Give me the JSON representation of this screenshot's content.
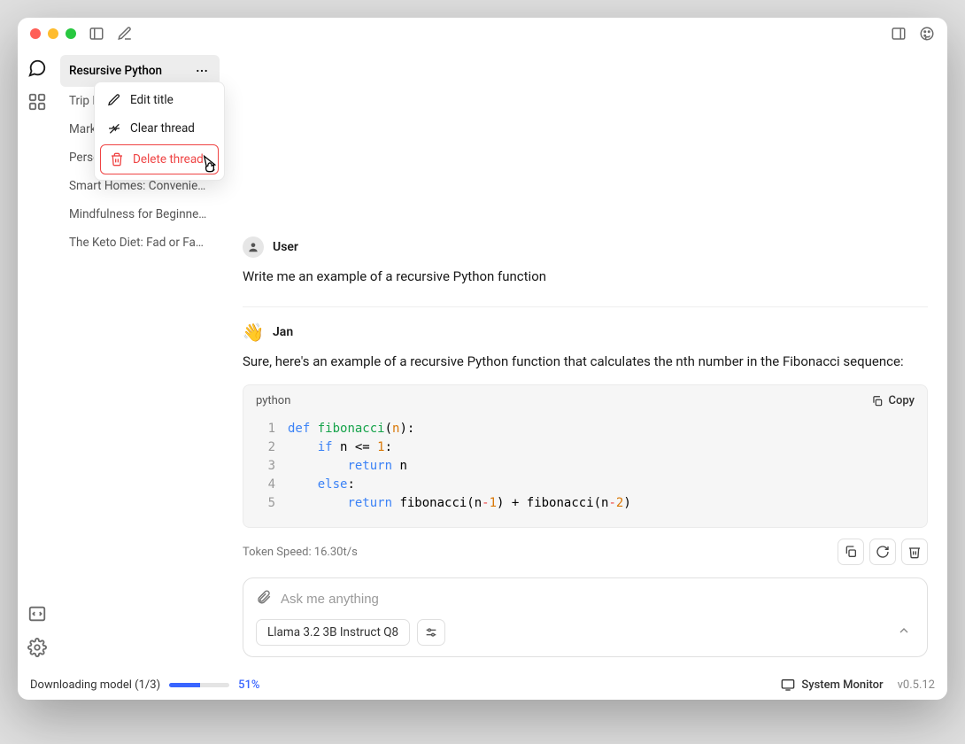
{
  "sidebar": {
    "threads": [
      {
        "label": "Resursive Python",
        "active": true
      },
      {
        "label": "Trip Planning Advice"
      },
      {
        "label": "Marketing Strategies"
      },
      {
        "label": "Personal Finance Tips"
      },
      {
        "label": "Smart Homes: Convenient?"
      },
      {
        "label": "Mindfulness for Beginne…"
      },
      {
        "label": "The Keto Diet: Fad or Fa…"
      }
    ]
  },
  "context_menu": {
    "edit": "Edit title",
    "clear": "Clear thread",
    "delete": "Delete thread"
  },
  "conversation": {
    "user_label": "User",
    "user_text": "Write me an example of a recursive Python function",
    "assistant_label": "Jan",
    "assistant_emoji": "👋",
    "assistant_text": "Sure, here's an example of a recursive Python function that calculates the nth number in the Fibonacci sequence:",
    "code_lang": "python",
    "copy_label": "Copy",
    "code_lines": [
      "def fibonacci(n):",
      "    if n <= 1:",
      "        return n",
      "    else:",
      "        return fibonacci(n-1) + fibonacci(n-2)"
    ],
    "token_speed": "Token Speed: 16.30t/s"
  },
  "composer": {
    "placeholder": "Ask me anything",
    "model": "Llama 3.2 3B Instruct Q8"
  },
  "status": {
    "download_label": "Downloading model (1/3)",
    "download_pct": "51%",
    "sysmon": "System Monitor",
    "version": "v0.5.12"
  }
}
